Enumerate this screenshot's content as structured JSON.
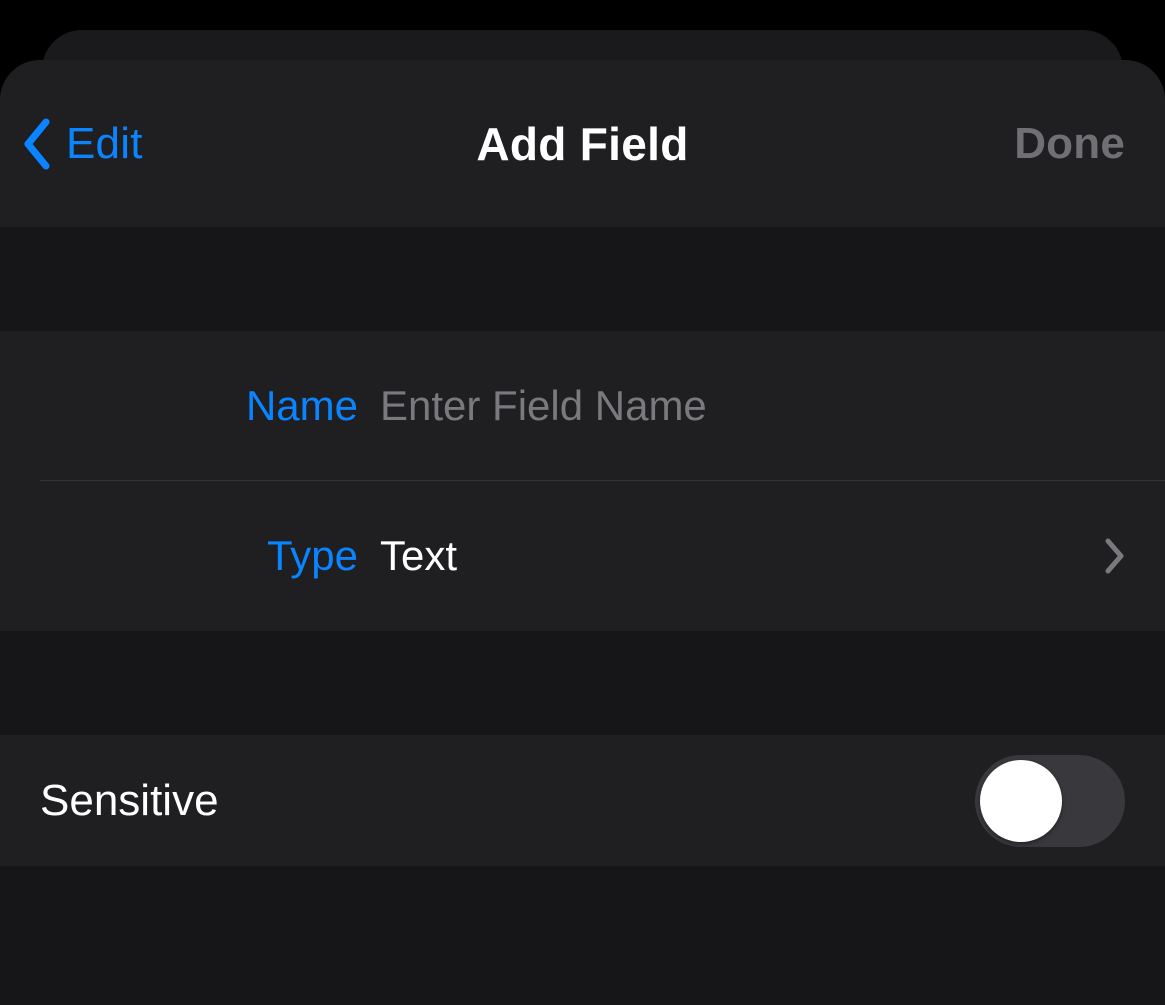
{
  "nav": {
    "back_label": "Edit",
    "title": "Add Field",
    "done_label": "Done"
  },
  "fields": {
    "name_label": "Name",
    "name_placeholder": "Enter Field Name",
    "name_value": "",
    "type_label": "Type",
    "type_value": "Text"
  },
  "sensitive": {
    "label": "Sensitive",
    "on": false
  },
  "colors": {
    "accent": "#0a84ff",
    "bg": "#161618",
    "row_bg": "#1f1f21",
    "placeholder": "#7a7a7e",
    "disabled": "#6f6f74"
  }
}
